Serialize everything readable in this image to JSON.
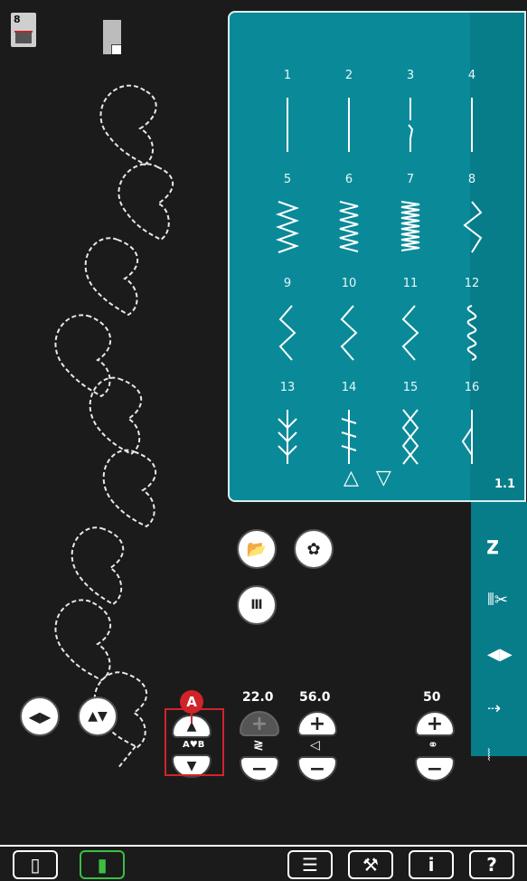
{
  "stitch_menu": {
    "stitches": [
      "1",
      "2",
      "3",
      "4",
      "5",
      "6",
      "7",
      "8",
      "9",
      "10",
      "11",
      "12",
      "13",
      "14",
      "15",
      "16"
    ],
    "page_label": "1.1",
    "scroll_up_icon": "triangle-up-outline-icon",
    "scroll_down_icon": "triangle-down-outline-icon"
  },
  "controls": {
    "width_value": "22.0",
    "length_value": "56.0",
    "density_value": "50",
    "plus_symbol": "+",
    "minus_symbol": "−",
    "callout_label": "A"
  },
  "colors": {
    "background": "#1b1b1b",
    "teal": "#0a8a98",
    "highlight": "#d2232a",
    "active_tab": "#3bbf43"
  }
}
